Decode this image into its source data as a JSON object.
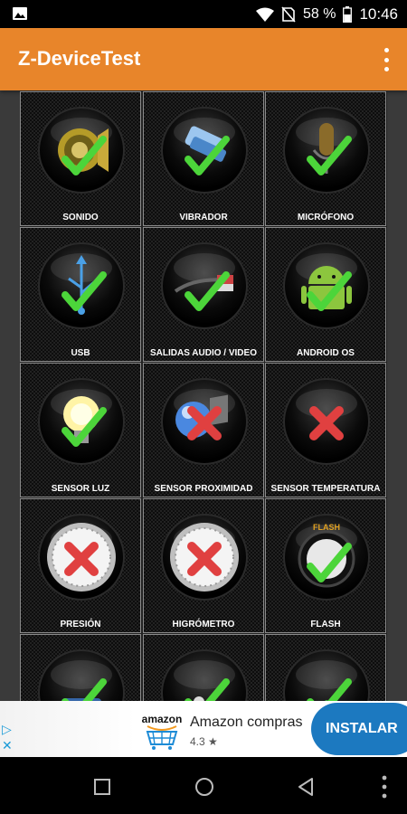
{
  "status_bar": {
    "battery": "58 %",
    "time": "10:46",
    "icons": [
      "image-icon",
      "wifi-icon",
      "no-sim-icon",
      "battery-icon"
    ]
  },
  "app_bar": {
    "title": "Z-DeviceTest",
    "menu_icon": "more-vert-icon"
  },
  "tests": [
    {
      "label": "SONIDO",
      "icon": "speaker-icon",
      "status": "ok"
    },
    {
      "label": "VIBRADOR",
      "icon": "vibrator-icon",
      "status": "ok"
    },
    {
      "label": "MICRÓFONO",
      "icon": "microphone-icon",
      "status": "ok"
    },
    {
      "label": "USB",
      "icon": "usb-icon",
      "status": "ok"
    },
    {
      "label": "SALIDAS AUDIO / VIDEO",
      "icon": "av-cable-icon",
      "status": "ok"
    },
    {
      "label": "ANDROID OS",
      "icon": "android-icon",
      "status": "ok"
    },
    {
      "label": "SENSOR LUZ",
      "icon": "light-bulb-icon",
      "status": "ok"
    },
    {
      "label": "SENSOR PROXIMIDAD",
      "icon": "proximity-icon",
      "status": "fail"
    },
    {
      "label": "SENSOR TEMPERATURA",
      "icon": "thermometer-icon",
      "status": "fail"
    },
    {
      "label": "PRESIÓN",
      "icon": "barometer-icon",
      "status": "fail"
    },
    {
      "label": "HIGRÓMETRO",
      "icon": "hygrometer-icon",
      "status": "fail"
    },
    {
      "label": "FLASH",
      "icon": "flash-icon",
      "status": "ok"
    },
    {
      "label": "",
      "icon": "display-icon",
      "status": "ok"
    },
    {
      "label": "",
      "icon": "multitouch-icon",
      "status": "ok"
    },
    {
      "label": "",
      "icon": "compass-icon",
      "status": "ok"
    }
  ],
  "ad": {
    "app_name": "Amazon compras",
    "rating": "4.3 ★",
    "logo_text": "amazon",
    "install_label": "INSTALAR",
    "adchoices_icon": "adchoices-icon",
    "close_icon": "close-icon"
  },
  "nav_bar": {
    "icons": [
      "recents-icon",
      "home-icon",
      "back-icon",
      "more-vert-icon"
    ]
  },
  "colors": {
    "app_bar": "#e8852a",
    "install_button": "#1c79c0",
    "check": "#4cd53a",
    "cross": "#e04040"
  }
}
